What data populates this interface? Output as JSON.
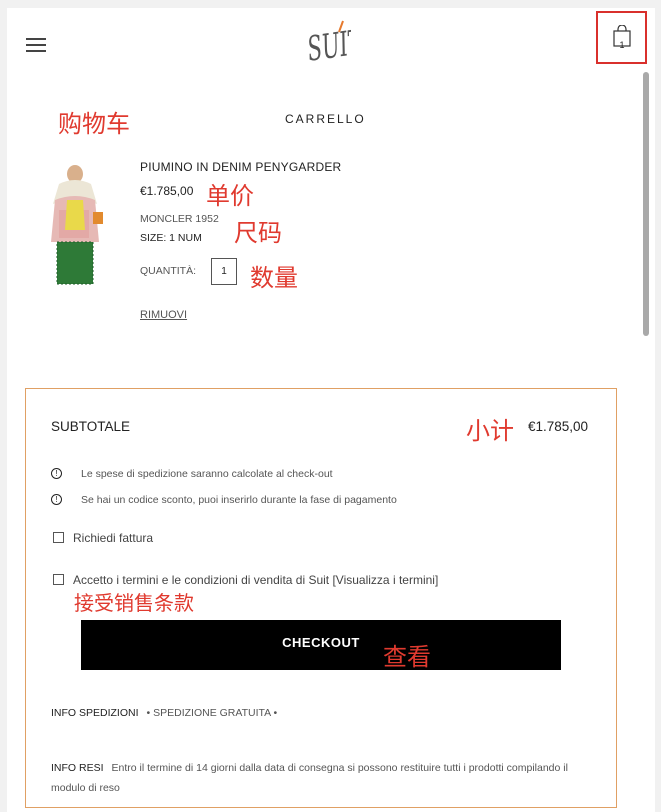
{
  "header": {
    "logo_text": "SUIT",
    "cart_count": "1"
  },
  "annotations": {
    "cart": "购物车",
    "unit_price": "单价",
    "size": "尺码",
    "quantity": "数量",
    "subtotal": "小计",
    "accept_terms": "接受销售条款",
    "checkout": "查看"
  },
  "cart": {
    "title": "CARRELLO",
    "item": {
      "name": "PIUMINO IN DENIM PENYGARDER",
      "price": "€1.785,00",
      "brand": "MONCLER 1952",
      "size": "SIZE: 1 NUM",
      "quantity_label": "QUANTITÀ:",
      "quantity_value": "1",
      "remove_label": "RIMUOVI"
    }
  },
  "summary": {
    "subtotal_label": "SUBTOTALE",
    "subtotal_value": "€1.785,00",
    "info_1": "Le spese di spedizione saranno calcolate al check-out",
    "info_2": "Se hai un codice sconto, puoi inserirlo durante la fase di pagamento",
    "invoice_label": "Richiedi fattura",
    "terms_label": "Accetto i termini e le condizioni di vendita di Suit [Visualizza i termini]",
    "checkout_label": "CHECKOUT",
    "shipping_key": "INFO SPEDIZIONI",
    "shipping_value": "• SPEDIZIONE GRATUITA •",
    "returns_key": "INFO RESI",
    "returns_value": "Entro il termine di 14 giorni dalla data di consegna si possono restituire tutti i prodotti compilando il modulo di reso"
  },
  "colors": {
    "annotation": "#e03a2f",
    "summary_border": "#e0a064",
    "checkout_bg": "#000000"
  }
}
